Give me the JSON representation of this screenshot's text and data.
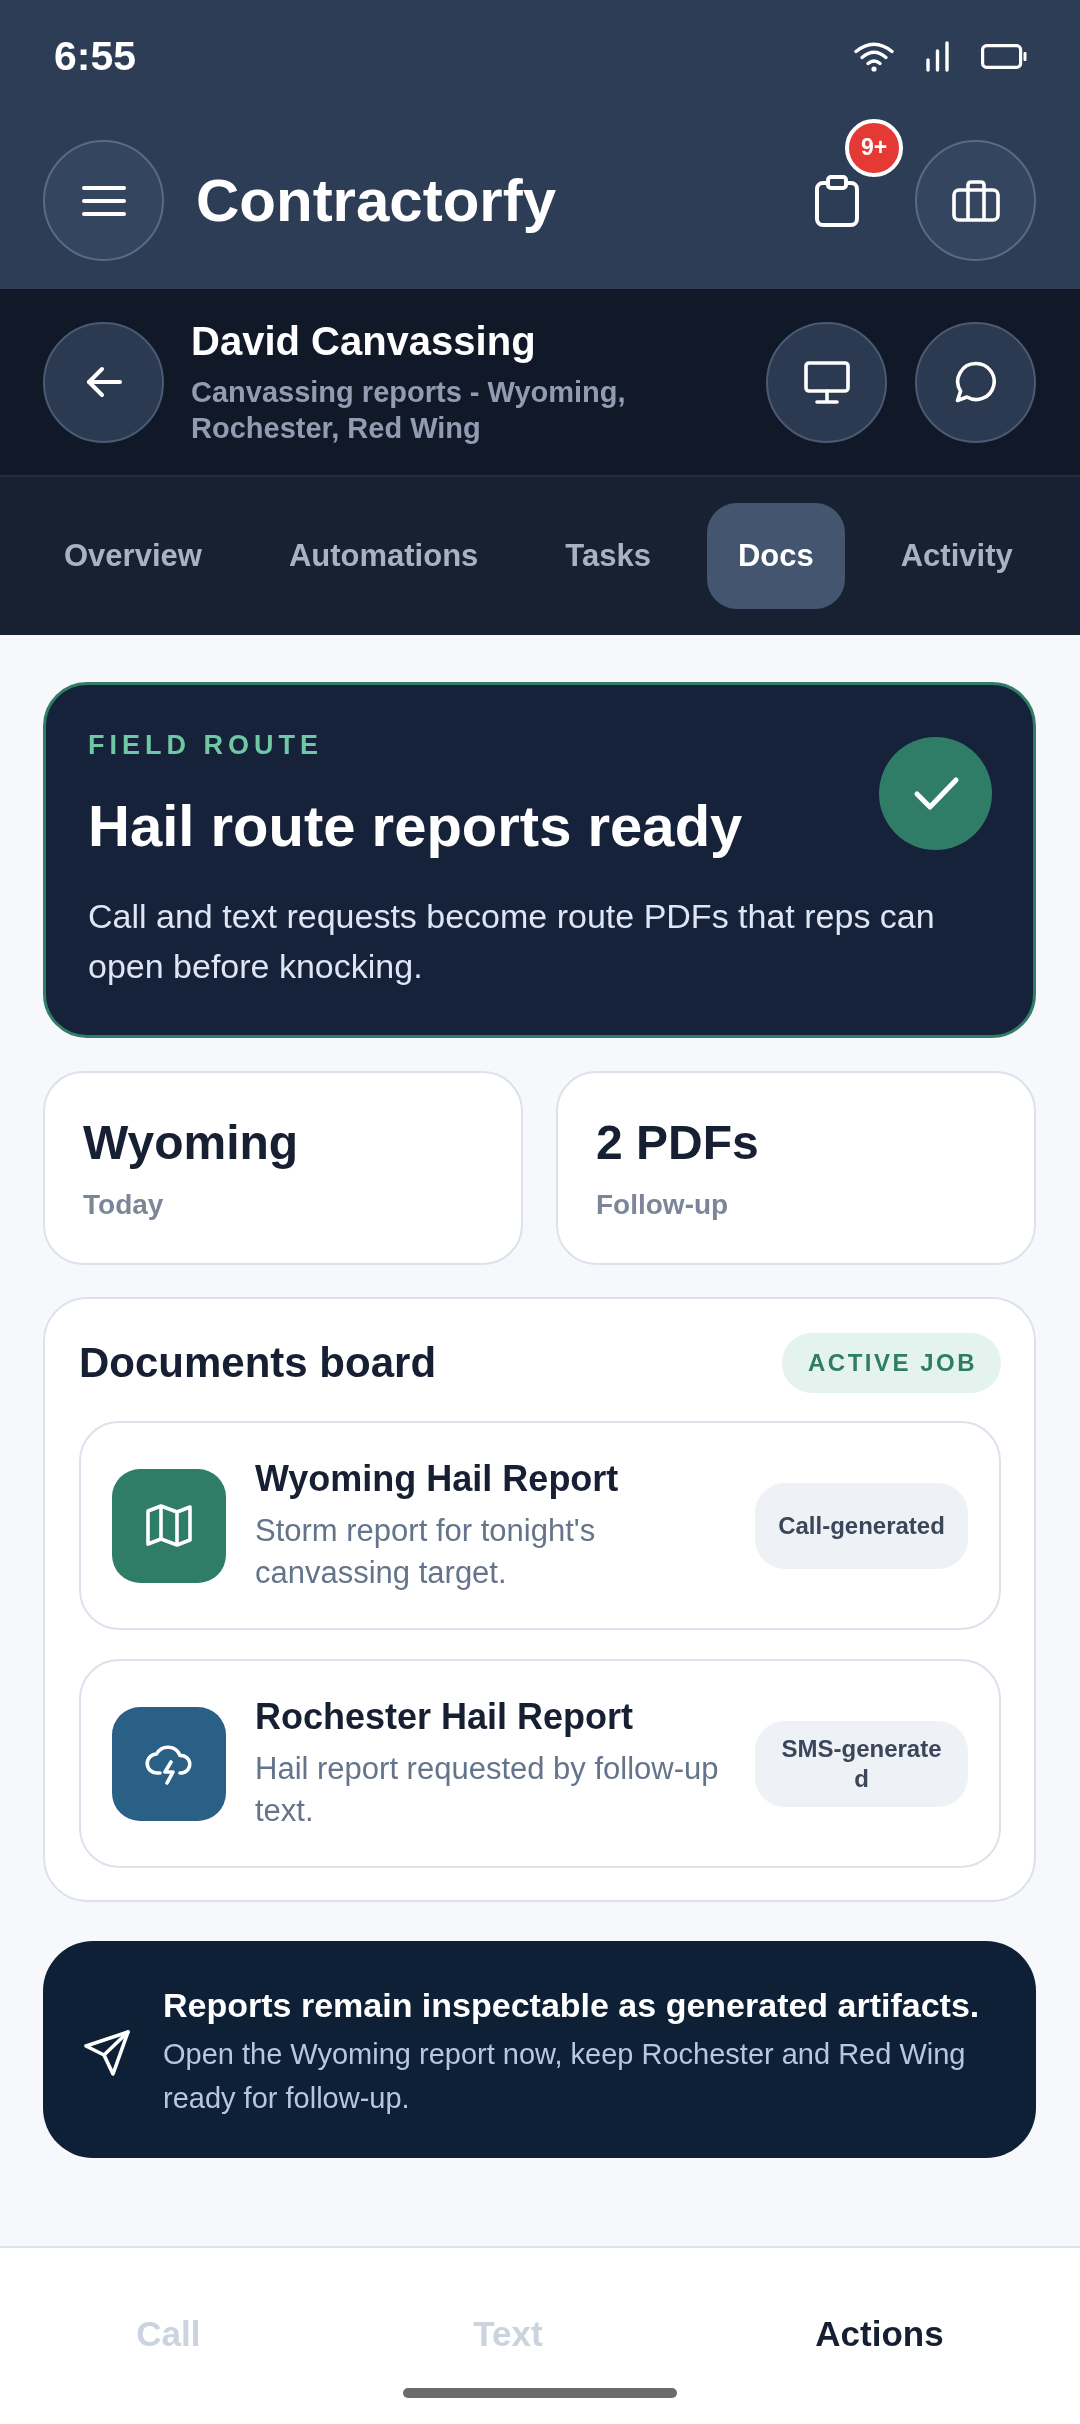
{
  "status_bar": {
    "time": "6:55"
  },
  "app_bar": {
    "title": "Contractorfy",
    "notification_count": "9+"
  },
  "job": {
    "title": "David Canvassing",
    "subtitle": "Canvassing reports - Wyoming, Rochester, Red Wing"
  },
  "tabs": [
    {
      "label": "Overview",
      "selected": false
    },
    {
      "label": "Automations",
      "selected": false
    },
    {
      "label": "Tasks",
      "selected": false
    },
    {
      "label": "Docs",
      "selected": true
    },
    {
      "label": "Activity",
      "selected": false
    }
  ],
  "hero": {
    "eyebrow": "FIELD ROUTE",
    "title": "Hail route reports ready",
    "body": "Call and text requests become route PDFs that reps can open before knocking."
  },
  "stats": [
    {
      "value": "Wyoming",
      "label": "Today"
    },
    {
      "value": "2 PDFs",
      "label": "Follow-up"
    }
  ],
  "documents_board": {
    "title": "Documents board",
    "status": "ACTIVE JOB",
    "documents": [
      {
        "kind": "map",
        "color": "#2f7d67",
        "title": "Wyoming Hail Report",
        "description": "Storm report for tonight's canvassing target.",
        "source": "Call-generated"
      },
      {
        "kind": "storm",
        "color": "#2a5f86",
        "title": "Rochester Hail Report",
        "description": "Hail report requested by follow-up text.",
        "source": "SMS-generated"
      }
    ]
  },
  "notice": {
    "title": "Reports remain inspectable as generated artifacts.",
    "body": "Open the Wyoming report now, keep Rochester and Red Wing ready for follow-up."
  },
  "bottom_nav": [
    {
      "label": "Call",
      "disabled": true
    },
    {
      "label": "Text",
      "disabled": true
    },
    {
      "label": "Actions",
      "disabled": false
    }
  ]
}
